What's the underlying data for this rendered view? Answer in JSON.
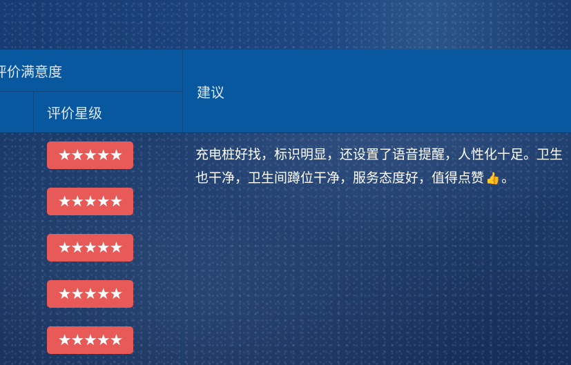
{
  "table": {
    "headers": {
      "satisfaction_group": "评价满意度",
      "stars_column": "评价星级",
      "advice_column": "建议"
    },
    "ratings": [
      {
        "stars": "★★★★★",
        "value": 5
      },
      {
        "stars": "★★★★★",
        "value": 5
      },
      {
        "stars": "★★★★★",
        "value": 5
      },
      {
        "stars": "★★★★★",
        "value": 5
      },
      {
        "stars": "★★★★★",
        "value": 5
      }
    ],
    "advice": {
      "text_before_icon": "充电桩好找，标识明显，还设置了语音提醒，人性化十足。卫生也干净，卫生间蹲位干净，服务态度好，值得点赞",
      "icon": "thumbs-up-icon",
      "text_after_icon": "。"
    }
  },
  "colors": {
    "header_bg": "#07589f",
    "star_badge": "#e85a58",
    "page_bg": "#1a3a6a"
  }
}
